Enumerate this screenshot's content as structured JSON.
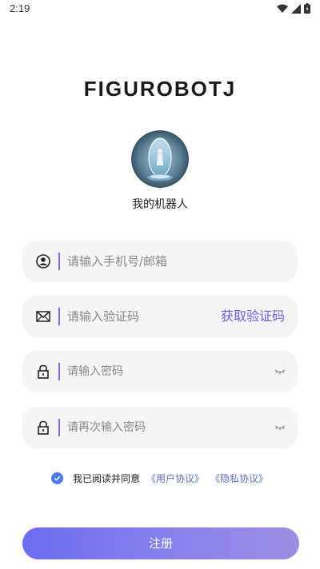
{
  "status_bar": {
    "time": "2:19",
    "icons": [
      "wifi-icon",
      "signal-icon",
      "battery-icon"
    ]
  },
  "brand": {
    "logo_text": "FIGUROBOTJ"
  },
  "robot": {
    "name": "我的机器人"
  },
  "form": {
    "account": {
      "placeholder": "请输入手机号/邮箱",
      "icon": "user-icon"
    },
    "code": {
      "placeholder": "请输入验证码",
      "icon": "mail-icon",
      "get_code_label": "获取验证码"
    },
    "password": {
      "placeholder": "请输入密码",
      "icon": "lock-icon"
    },
    "confirm_password": {
      "placeholder": "请再次输入密码",
      "icon": "lock-icon"
    }
  },
  "agreement": {
    "checked": true,
    "text": "我已阅读并同意",
    "user_agreement": "《用户协议》",
    "privacy_policy": "《隐私协议》"
  },
  "register_label": "注册",
  "colors": {
    "accent": "#6a62e0",
    "field_bg": "#f5f5f7",
    "check": "#4c7bf0",
    "button_start": "#6e6cf0",
    "button_end": "#9b8ee2"
  }
}
